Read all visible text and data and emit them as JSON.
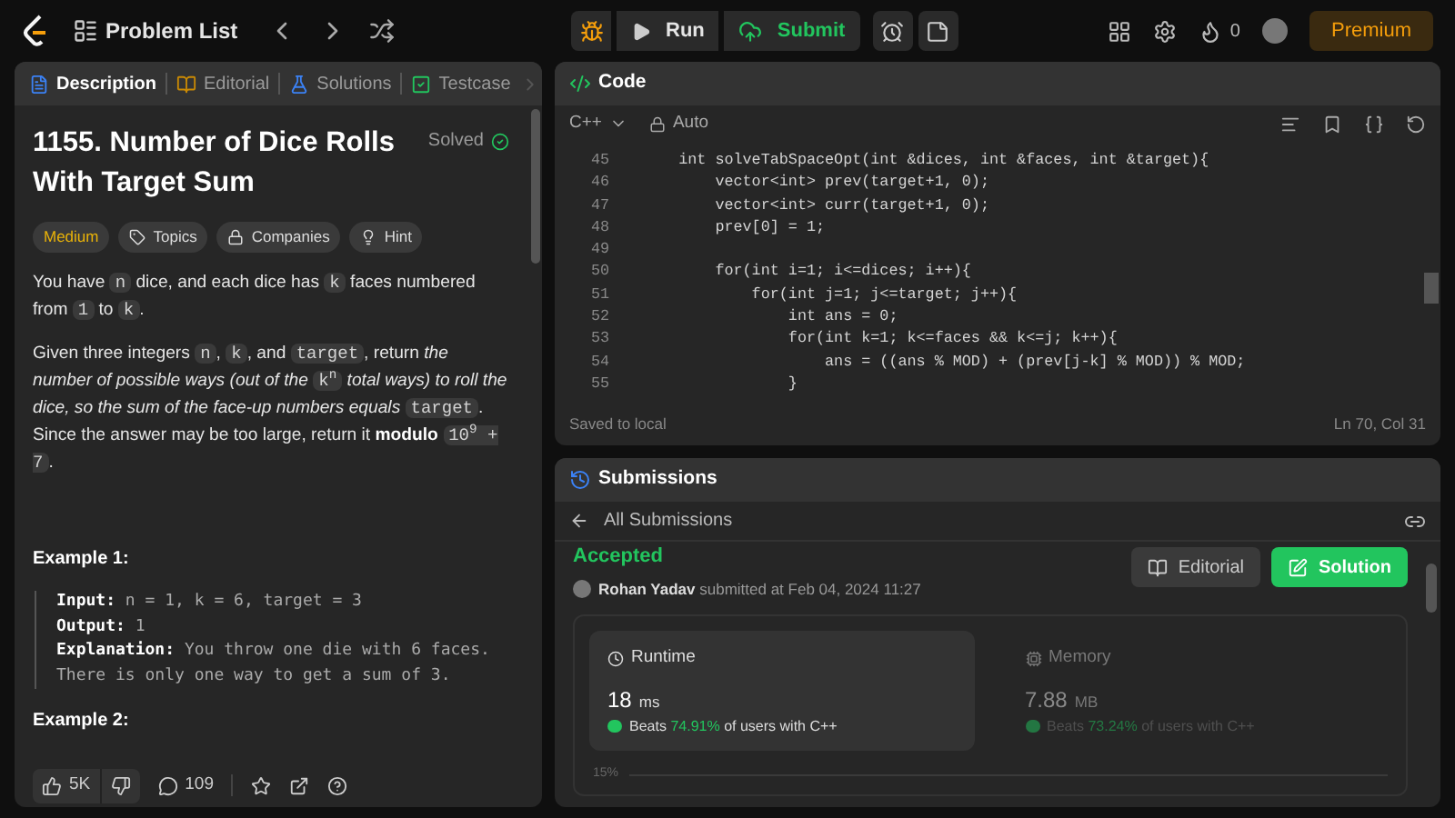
{
  "topbar": {
    "title": "Problem List",
    "run": "Run",
    "submit": "Submit",
    "streak": "0",
    "premium": "Premium"
  },
  "left_tabs": [
    {
      "label": "Description",
      "selected": true
    },
    {
      "label": "Editorial",
      "selected": false
    },
    {
      "label": "Solutions",
      "selected": false
    },
    {
      "label": "Testcase",
      "selected": false
    }
  ],
  "problem": {
    "title": "1155. Number of Dice Rolls With Target Sum",
    "status": "Solved",
    "difficulty": "Medium",
    "tags": [
      {
        "label": "Topics"
      },
      {
        "label": "Companies"
      },
      {
        "label": "Hint"
      }
    ],
    "paragraphs": [
      [
        {
          "kind": "text",
          "text": "You have "
        },
        {
          "kind": "code",
          "text": "n"
        },
        {
          "kind": "text",
          "text": " dice, and each dice has "
        },
        {
          "kind": "code",
          "text": "k"
        },
        {
          "kind": "text",
          "text": " faces numbered from "
        },
        {
          "kind": "code",
          "text": "1"
        },
        {
          "kind": "text",
          "text": " to "
        },
        {
          "kind": "code",
          "text": "k"
        },
        {
          "kind": "text",
          "text": "."
        }
      ],
      [
        {
          "kind": "text",
          "text": "Given three integers "
        },
        {
          "kind": "code",
          "text": "n"
        },
        {
          "kind": "text",
          "text": ", "
        },
        {
          "kind": "code",
          "text": "k"
        },
        {
          "kind": "text",
          "text": ", and "
        },
        {
          "kind": "code",
          "text": "target"
        },
        {
          "kind": "text",
          "text": ", return "
        },
        {
          "kind": "italic",
          "text": "the number of possible ways (out of the "
        },
        {
          "kind": "code",
          "text": "k$^{n}$"
        },
        {
          "kind": "italic",
          "text": " total ways) to roll the dice, so the sum of the face-up numbers equals "
        },
        {
          "kind": "code",
          "text": "target"
        },
        {
          "kind": "text",
          "text": ". Since the answer may be too large, return it "
        },
        {
          "kind": "bold",
          "text": "modulo "
        },
        {
          "kind": "code",
          "text": "10$^{9}$ + 7"
        },
        {
          "kind": "text",
          "text": "."
        }
      ]
    ],
    "examples": [
      {
        "title": "Example 1:",
        "lines": [
          {
            "label": "Input:",
            "text": " n = 1, k = 6, target = 3"
          },
          {
            "label": "Output:",
            "text": " 1"
          },
          {
            "label": "Explanation:",
            "text": " You throw one die with 6 faces.\nThere is only one way to get a sum of 3."
          }
        ]
      },
      {
        "title": "Example 2:"
      }
    ],
    "likes": "5K",
    "comments": "109"
  },
  "code": {
    "title": "Code",
    "language": "C++",
    "mode": "Auto",
    "lines": [
      {
        "n": "45",
        "text": "    int solveTabSpaceOpt(int &dices, int &faces, int &target){"
      },
      {
        "n": "46",
        "text": "        vector<int> prev(target+1, 0);"
      },
      {
        "n": "47",
        "text": "        vector<int> curr(target+1, 0);"
      },
      {
        "n": "48",
        "text": "        prev[0] = 1;"
      },
      {
        "n": "49"
      },
      {
        "n": "50",
        "text": "        for(int i=1; i<=dices; i++){"
      },
      {
        "n": "51",
        "text": "            for(int j=1; j<=target; j++){"
      },
      {
        "n": "52",
        "text": "                int ans = 0;"
      },
      {
        "n": "53",
        "text": "                for(int k=1; k<=faces && k<=j; k++){"
      },
      {
        "n": "54",
        "text": "                    ans = ((ans % MOD) + (prev[j-k] % MOD)) % MOD;"
      },
      {
        "n": "55",
        "text": "                }"
      }
    ],
    "saved": "Saved to local",
    "cursor": "Ln 70, Col 31"
  },
  "submissions": {
    "title": "Submissions",
    "back": "All Submissions",
    "verdict": "Accepted",
    "user": "Rohan Yadav",
    "submitted": "submitted at Feb 04, 2024 11:27",
    "editorial": "Editorial",
    "solution": "Solution",
    "stats": [
      {
        "label": "Runtime",
        "value": "18",
        "unit": "ms",
        "beats_label": "Beats",
        "percent": "74.91%",
        "suffix": "of users with C++",
        "selected": true
      },
      {
        "label": "Memory",
        "value": "7.88",
        "unit": "MB",
        "beats_label": "Beats",
        "percent": "73.24%",
        "suffix": "of users with C++",
        "selected": false
      }
    ],
    "axis_label": "15%"
  }
}
